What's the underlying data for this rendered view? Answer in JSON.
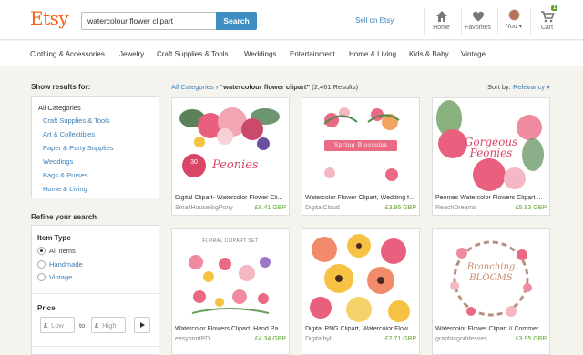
{
  "header": {
    "logo": "Etsy",
    "search_value": "watercolour flower clipart",
    "search_button": "Search",
    "sell_link": "Sell on Etsy",
    "nav": [
      {
        "label": "Home",
        "icon": "home-icon"
      },
      {
        "label": "Favorites",
        "icon": "heart-icon"
      },
      {
        "label": "You",
        "icon": "avatar"
      },
      {
        "label": "Cart",
        "icon": "cart-icon"
      }
    ],
    "cart_count": "1"
  },
  "categories": [
    "Clothing & Accessories",
    "Jewelry",
    "Craft Supplies & Tools",
    "Weddings",
    "Entertainment",
    "Home & Living",
    "Kids & Baby",
    "Vintage"
  ],
  "sidebar": {
    "show_results_for": "Show results for:",
    "all_categories": "All Categories",
    "category_links": [
      "Craft Supplies & Tools",
      "Art & Collectibles",
      "Paper & Party Supplies",
      "Weddings",
      "Bags & Purses",
      "Home & Living"
    ],
    "refine_title": "Refine your search",
    "item_type_label": "Item Type",
    "item_types": [
      "All Items",
      "Handmade",
      "Vintage"
    ],
    "selected_item_type": "All Items",
    "price_label": "Price",
    "currency": "£",
    "price_low_placeholder": "Low",
    "price_to": "to",
    "price_high_placeholder": "High"
  },
  "results": {
    "breadcrumb_link": "All Categories",
    "breadcrumb_sep": "›",
    "query": "“watercolour flower clipart”",
    "count": "(2,461 Results)",
    "sort_label": "Sort by:",
    "sort_value": "Relevancy"
  },
  "listings": [
    {
      "title": "Digital Clipart- Watercolor Flower Cli...",
      "shop": "SmallHouseBigPony",
      "price": "£6.41 GBP",
      "art": "Peonies"
    },
    {
      "title": "Watercolor Flower Clipart, Wedding f...",
      "shop": "DigitalCloud",
      "price": "£3.95 GBP",
      "art": "Spring Blossoms"
    },
    {
      "title": "Peonies Watercolor Flowers Clipart ...",
      "shop": "ReachDreams",
      "price": "£5.93 GBP",
      "art": "Gorgeous Peonies"
    },
    {
      "title": "Watercolor Flowers Clipart, Hand Pa...",
      "shop": "easyprintPD",
      "price": "£4.34 GBP",
      "art": "FLORAL CLIPART SET"
    },
    {
      "title": "Digital PNG Clipart, Watercolor Flow...",
      "shop": "Digitalbyli",
      "price": "£2.71 GBP",
      "art": ""
    },
    {
      "title": "Watercolor Flower Clipart // Commer...",
      "shop": "graphicgoddesses",
      "price": "£3.95 GBP",
      "art": "Branching BLOOMS"
    }
  ],
  "colors": {
    "brand": "#f1641e",
    "link": "#3f7fb5",
    "button": "#3d8ec2",
    "price": "#5fa22e"
  }
}
